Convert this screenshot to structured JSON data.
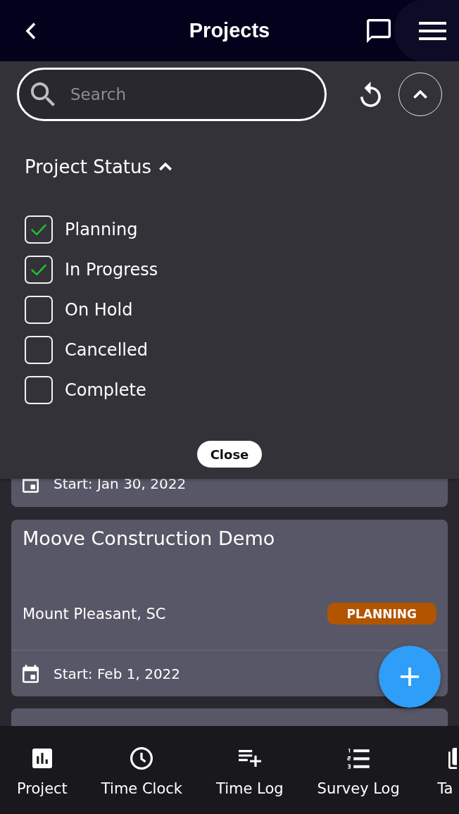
{
  "header": {
    "title": "Projects"
  },
  "filter_panel": {
    "expanded": true,
    "search": {
      "placeholder": "Search"
    },
    "section": {
      "title": "Project Status",
      "expanded": true
    },
    "options": [
      {
        "label": "Planning",
        "checked": true
      },
      {
        "label": "In Progress",
        "checked": true
      },
      {
        "label": "On Hold",
        "checked": false
      },
      {
        "label": "Cancelled",
        "checked": false
      },
      {
        "label": "Complete",
        "checked": false
      }
    ],
    "close_button": "Close"
  },
  "projects": [
    {
      "start": "Start: Jan 30, 2022"
    },
    {
      "title": "Moove Construction Demo",
      "location": "Mount Pleasant, SC",
      "status": {
        "label": "PLANNING",
        "color": "#b35400"
      },
      "start": "Start: Feb 1, 2022"
    }
  ],
  "bottom_nav": [
    {
      "label": "Project",
      "kind": "chart"
    },
    {
      "label": "Time Clock",
      "kind": "clock"
    },
    {
      "label": "Time Log",
      "kind": "list-plus"
    },
    {
      "label": "Survey Log",
      "kind": "numbered-list"
    },
    {
      "label": "Ta",
      "kind": "stack"
    }
  ]
}
